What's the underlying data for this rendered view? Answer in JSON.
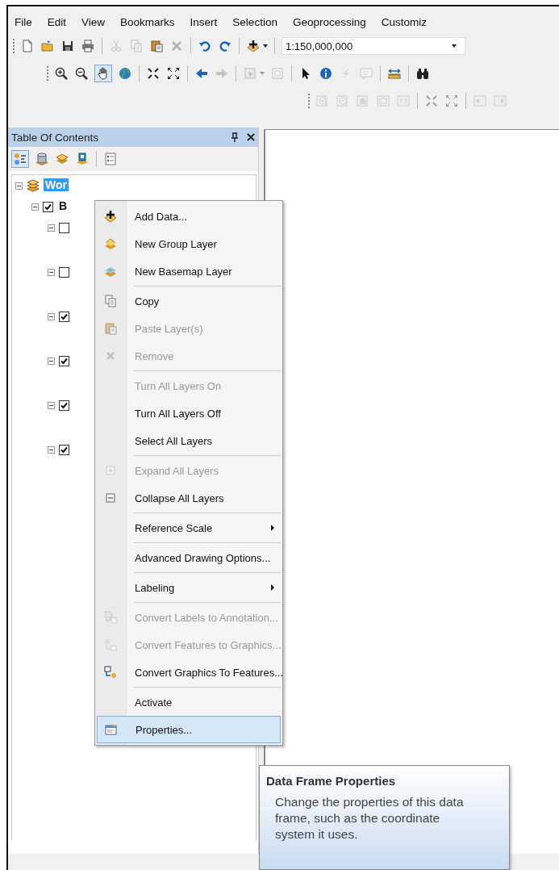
{
  "menu_bar": {
    "items": [
      "File",
      "Edit",
      "View",
      "Bookmarks",
      "Insert",
      "Selection",
      "Geoprocessing",
      "Customiz"
    ]
  },
  "toolbars": [
    {
      "groups": [
        [
          {
            "kind": "new",
            "disabled": false,
            "selected": false
          },
          {
            "kind": "open",
            "disabled": false,
            "selected": false
          },
          {
            "kind": "save",
            "disabled": false,
            "selected": false
          },
          {
            "kind": "print",
            "disabled": false,
            "selected": false
          }
        ],
        [
          {
            "kind": "cut",
            "disabled": true,
            "selected": false
          },
          {
            "kind": "copy",
            "disabled": true,
            "selected": false
          },
          {
            "kind": "paste",
            "disabled": false,
            "selected": false
          },
          {
            "kind": "delete",
            "disabled": true,
            "selected": false
          }
        ],
        [
          {
            "kind": "undo",
            "disabled": false,
            "selected": false
          },
          {
            "kind": "redo",
            "disabled": false,
            "selected": false
          }
        ],
        [
          {
            "kind": "add-data",
            "disabled": false,
            "selected": false,
            "dropdown": true
          }
        ]
      ],
      "scale": {
        "value": "1:150,000,000"
      }
    },
    {
      "groups": [
        [
          {
            "kind": "zoom-in",
            "disabled": false,
            "selected": false
          },
          {
            "kind": "zoom-out",
            "disabled": false,
            "selected": false
          },
          {
            "kind": "pan",
            "disabled": false,
            "selected": true
          },
          {
            "kind": "globe",
            "disabled": false,
            "selected": false
          }
        ],
        [
          {
            "kind": "fixed-in",
            "disabled": false,
            "selected": false
          },
          {
            "kind": "fixed-out",
            "disabled": false,
            "selected": false
          }
        ],
        [
          {
            "kind": "back",
            "disabled": false,
            "selected": false
          },
          {
            "kind": "forward",
            "disabled": true,
            "selected": false
          }
        ],
        [
          {
            "kind": "select-graphics",
            "disabled": true,
            "selected": false,
            "dropdown": true
          },
          {
            "kind": "clear",
            "disabled": true,
            "selected": false
          }
        ],
        [
          {
            "kind": "pointer",
            "disabled": false,
            "selected": false
          },
          {
            "kind": "identify",
            "disabled": false,
            "selected": false
          },
          {
            "kind": "hyperlink",
            "disabled": true,
            "selected": false
          },
          {
            "kind": "popup",
            "disabled": true,
            "selected": false
          }
        ],
        [
          {
            "kind": "measure",
            "disabled": false,
            "selected": false
          }
        ],
        [
          {
            "kind": "find",
            "disabled": false,
            "selected": false
          }
        ]
      ]
    },
    {
      "groups": [
        [
          {
            "kind": "page-zoom-in",
            "disabled": true,
            "selected": false
          },
          {
            "kind": "page-zoom-out",
            "disabled": true,
            "selected": false
          },
          {
            "kind": "page-pan",
            "disabled": true,
            "selected": false
          },
          {
            "kind": "page-full",
            "disabled": true,
            "selected": false
          },
          {
            "kind": "page-actual",
            "disabled": true,
            "selected": false
          }
        ],
        [
          {
            "kind": "fixed-in",
            "disabled": true,
            "selected": false
          },
          {
            "kind": "fixed-out",
            "disabled": true,
            "selected": false
          }
        ],
        [
          {
            "kind": "page-back",
            "disabled": true,
            "selected": false
          },
          {
            "kind": "page-forward",
            "disabled": true,
            "selected": false
          }
        ]
      ]
    }
  ],
  "toc": {
    "title": "Table Of Contents",
    "tools": [
      {
        "kind": "drawing-order",
        "selected": true
      },
      {
        "kind": "source",
        "selected": false
      },
      {
        "kind": "visibility",
        "selected": false
      },
      {
        "kind": "selection",
        "selected": false
      },
      {
        "kind": "options",
        "selected": false
      }
    ],
    "tree": [
      {
        "kind": "data-frame",
        "label": "Wor",
        "selected": true,
        "expanded": true,
        "children": [
          {
            "kind": "layer",
            "label": "B",
            "checked": true,
            "expanded": true,
            "selected": false,
            "children": [
              {
                "kind": "layer",
                "checked": false,
                "expanded": true
              },
              {
                "kind": "layer",
                "checked": false,
                "expanded": true
              },
              {
                "kind": "layer",
                "checked": true,
                "expanded": true
              },
              {
                "kind": "layer",
                "checked": true,
                "expanded": true
              },
              {
                "kind": "layer",
                "checked": true,
                "expanded": true
              },
              {
                "kind": "layer",
                "checked": true,
                "expanded": true
              }
            ]
          }
        ]
      }
    ]
  },
  "context_menu": {
    "items": [
      {
        "kind": "add-data",
        "label": "Add Data...",
        "disabled": false,
        "selected": false
      },
      {
        "kind": "group-layer",
        "label": "New Group Layer",
        "disabled": false,
        "selected": false
      },
      {
        "kind": "basemap",
        "label": "New Basemap Layer",
        "disabled": false,
        "selected": false
      },
      {
        "kind": "copy",
        "label": "Copy",
        "disabled": false,
        "selected": false,
        "separator_before": true
      },
      {
        "kind": "paste",
        "label": "Paste Layer(s)",
        "disabled": true,
        "selected": false
      },
      {
        "kind": "remove",
        "label": "Remove",
        "disabled": true,
        "selected": false
      },
      {
        "kind": "none",
        "label": "Turn All Layers On",
        "disabled": true,
        "selected": false,
        "separator_before": true
      },
      {
        "kind": "none",
        "label": "Turn All Layers Off",
        "disabled": false,
        "selected": false
      },
      {
        "kind": "none",
        "label": "Select All Layers",
        "disabled": false,
        "selected": false
      },
      {
        "kind": "expand",
        "label": "Expand All Layers",
        "disabled": true,
        "selected": false,
        "separator_before": true
      },
      {
        "kind": "collapse",
        "label": "Collapse All Layers",
        "disabled": false,
        "selected": false
      },
      {
        "kind": "none",
        "label": "Reference Scale",
        "disabled": false,
        "selected": false,
        "submenu": true,
        "separator_before": true
      },
      {
        "kind": "none",
        "label": "Advanced Drawing Options...",
        "disabled": false,
        "selected": false,
        "separator_before": true
      },
      {
        "kind": "none",
        "label": "Labeling",
        "disabled": false,
        "selected": false,
        "submenu": true,
        "separator_before": true
      },
      {
        "kind": "labels-annotation",
        "label": "Convert Labels to Annotation...",
        "disabled": true,
        "selected": false,
        "separator_before": true
      },
      {
        "kind": "features-graphics",
        "label": "Convert Features to Graphics...",
        "disabled": true,
        "selected": false
      },
      {
        "kind": "graphics-features",
        "label": "Convert Graphics To Features...",
        "disabled": false,
        "selected": false
      },
      {
        "kind": "none",
        "label": "Activate",
        "disabled": false,
        "selected": false,
        "separator_before": true
      },
      {
        "kind": "properties",
        "label": "Properties...",
        "disabled": false,
        "selected": true
      }
    ]
  },
  "tooltip": {
    "title": "Data Frame Properties",
    "text": "Change the properties of this data frame, such as the coordinate system it uses."
  }
}
